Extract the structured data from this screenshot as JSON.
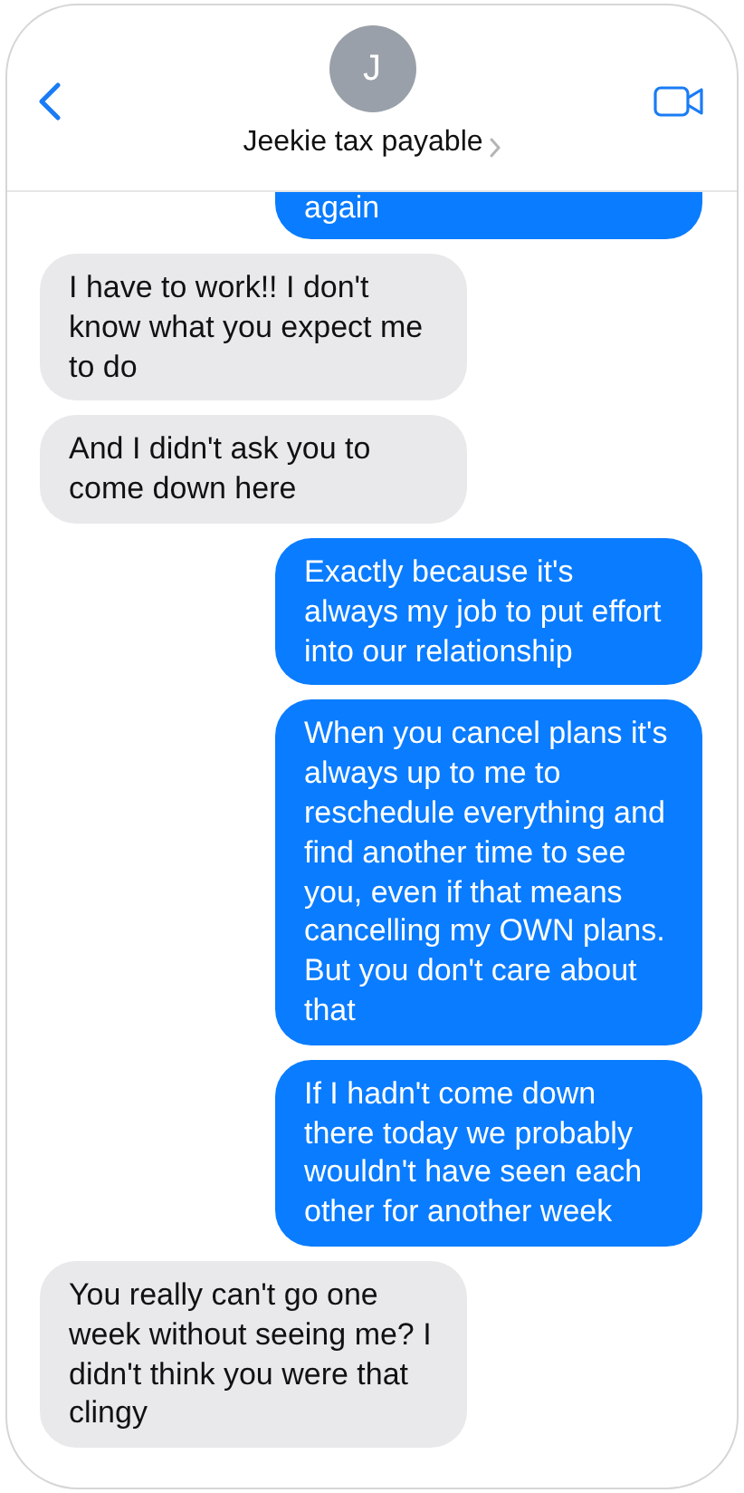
{
  "header": {
    "avatar_initial": "J",
    "contact_name": "Jeekie tax payable"
  },
  "messages": [
    {
      "kind": "sent",
      "text": "again",
      "cut": true
    },
    {
      "kind": "received",
      "text": "I have to work!! I don't know what you expect me to do"
    },
    {
      "kind": "received",
      "text": "And I didn't ask you to come down here"
    },
    {
      "kind": "sent",
      "text": "Exactly because it's always my job to put effort into our relationship"
    },
    {
      "kind": "sent",
      "text": "When you cancel plans it's always up to me to reschedule everything and find another time to see you, even if that means cancelling my OWN plans. But you don't care about that"
    },
    {
      "kind": "sent",
      "text": "If I hadn't come down there today we probably wouldn't have seen each other for another week"
    },
    {
      "kind": "received",
      "text": "You really can't go one week without seeing me? I didn't think you were that clingy"
    }
  ]
}
